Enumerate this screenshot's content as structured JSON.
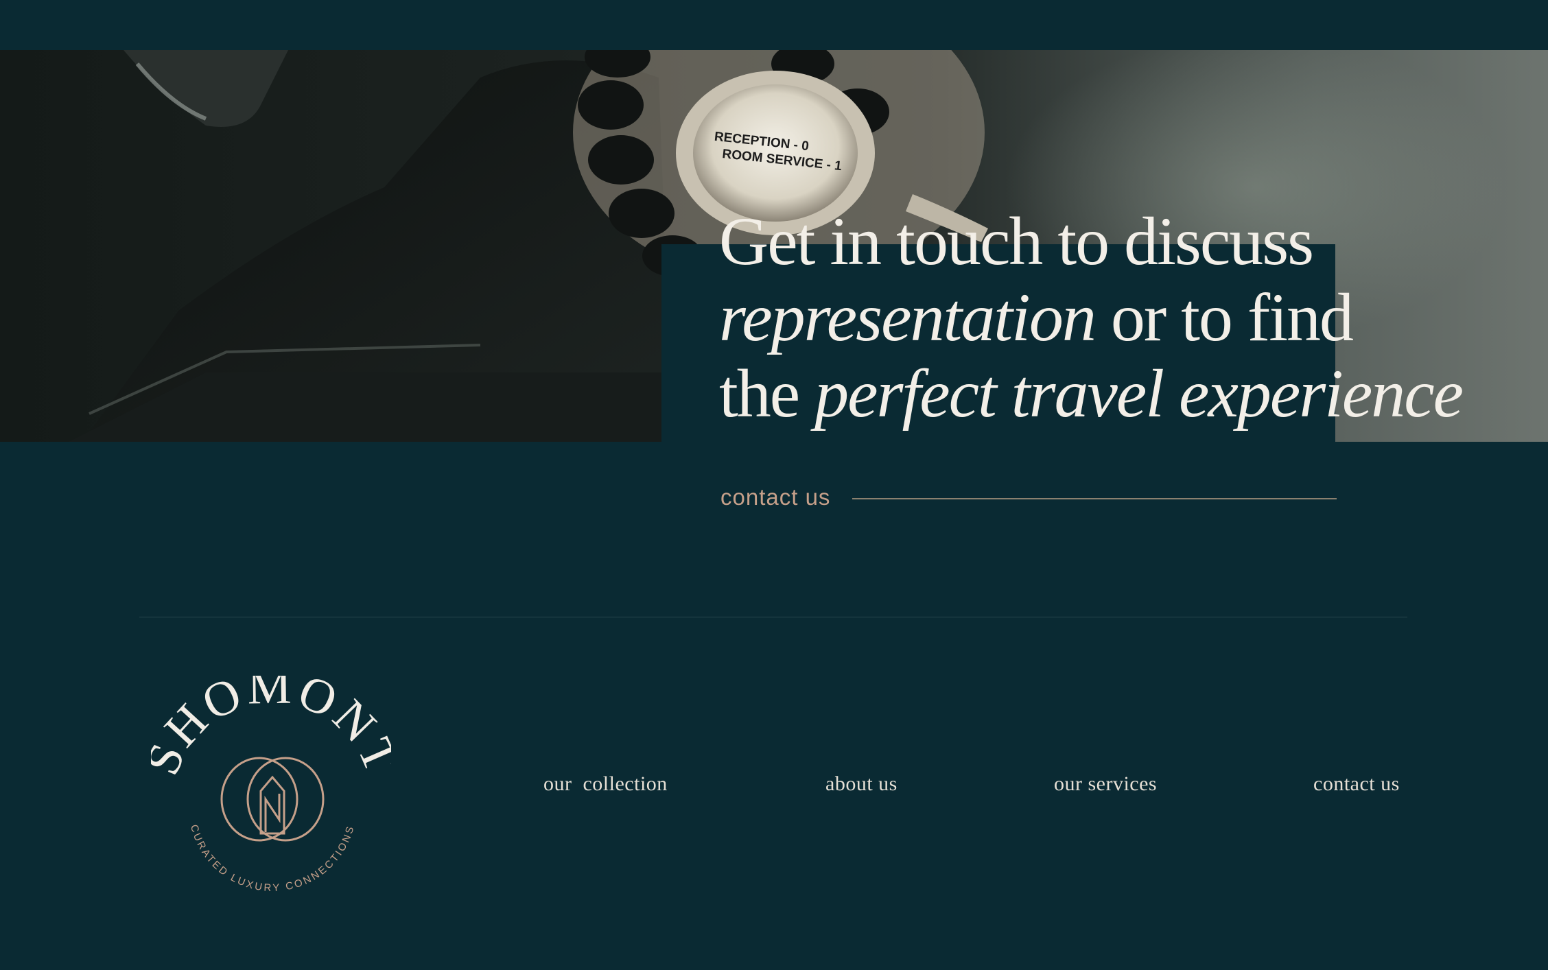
{
  "hero": {
    "image_description_icon": "rotary-telephone-photo",
    "dial_text_line1": "RECEPTION - 0",
    "dial_text_line2": "ROOM SERVICE - 1"
  },
  "headline": {
    "line1": "Get in touch to discuss",
    "line2_italic": "representation",
    "line2_rest": " or to find",
    "line3_start": "the ",
    "line3_italic": "perfect travel experience"
  },
  "cta": {
    "label": "contact us"
  },
  "logo": {
    "name": "SHOMONT",
    "tagline": "CURATED LUXURY CONNECTIONS",
    "icon": "house-in-rings-icon"
  },
  "footer_nav": [
    {
      "label": "our  collection"
    },
    {
      "label": "about us"
    },
    {
      "label": "our services"
    },
    {
      "label": "contact us"
    }
  ],
  "colors": {
    "background": "#0a2a33",
    "accent": "#c6a08a",
    "text": "#f3efe8"
  }
}
